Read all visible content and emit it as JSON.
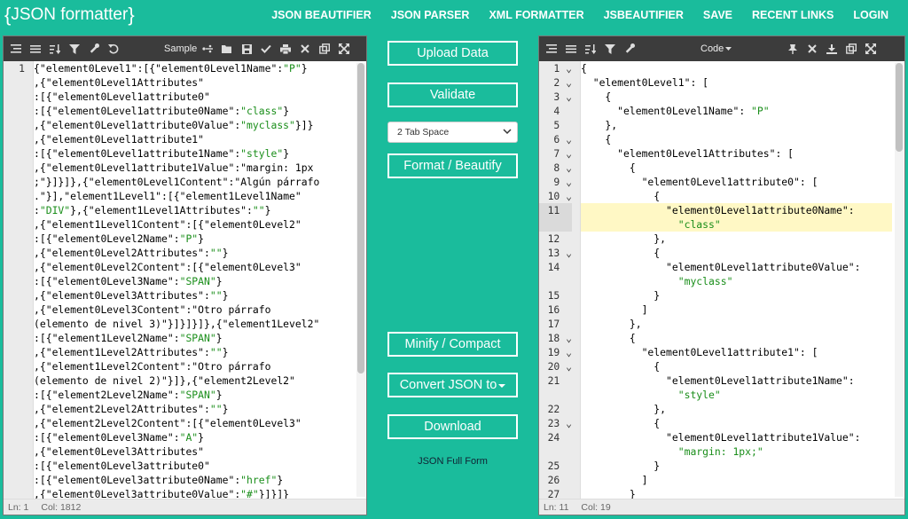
{
  "logo": {
    "open": "{",
    "text": "JSON formatter",
    "close": "}"
  },
  "nav": [
    "JSON BEAUTIFIER",
    "JSON PARSER",
    "XML FORMATTER",
    "JSBEAUTIFIER",
    "SAVE",
    "RECENT LINKS",
    "LOGIN"
  ],
  "left_panel": {
    "sample_label": "Sample",
    "line_number": "1",
    "status_ln": "Ln: 1",
    "status_col": "Col: 1812",
    "lines": [
      "{\"element0Level1\":[{\"element0Level1Name\":\"P\"}",
      ",{\"element0Level1Attributes\"",
      ":[{\"element0Level1attribute0\"",
      ":[{\"element0Level1attribute0Name\":\"class\"}",
      ",{\"element0Level1attribute0Value\":\"myclass\"}]}",
      ",{\"element0Level1attribute1\"",
      ":[{\"element0Level1attribute1Name\":\"style\"}",
      ",{\"element0Level1attribute1Value\":\"margin: 1px",
      ";\"}]}]},{\"element0Level1Content\":\"Algún párrafo",
      ".\"}],\"element1Level1\":[{\"element1Level1Name\"",
      ":\"DIV\"},{\"element1Level1Attributes\":\"\"}",
      ",{\"element1Level1Content\":[{\"element0Level2\"",
      ":[{\"element0Level2Name\":\"P\"}",
      ",{\"element0Level2Attributes\":\"\"}",
      ",{\"element0Level2Content\":[{\"element0Level3\"",
      ":[{\"element0Level3Name\":\"SPAN\"}",
      ",{\"element0Level3Attributes\":\"\"}",
      ",{\"element0Level3Content\":\"Otro párrafo",
      "(elemento de nivel 3)\"}]}]}]},{\"element1Level2\"",
      ":[{\"element1Level2Name\":\"SPAN\"}",
      ",{\"element1Level2Attributes\":\"\"}",
      ",{\"element1Level2Content\":\"Otro párrafo",
      "(elemento de nivel 2)\"}]},{\"element2Level2\"",
      ":[{\"element2Level2Name\":\"SPAN\"}",
      ",{\"element2Level2Attributes\":\"\"}",
      ",{\"element2Level2Content\":[{\"element0Level3\"",
      ":[{\"element0Level3Name\":\"A\"}",
      ",{\"element0Level3Attributes\"",
      ":[{\"element0Level3attribute0\"",
      ":[{\"element0Level3attribute0Name\":\"href\"}",
      ",{\"element0Level3attribute0Value\":\"#\"}]}]}"
    ]
  },
  "middle": {
    "upload": "Upload Data",
    "validate": "Validate",
    "tab_space": "2 Tab Space",
    "format": "Format / Beautify",
    "minify": "Minify / Compact",
    "convert": "Convert JSON to",
    "download": "Download",
    "full_form": "JSON Full Form"
  },
  "right_panel": {
    "code_label": "Code",
    "status_ln": "Ln: 11",
    "status_col": "Col: 19",
    "line_numbers": [
      "1",
      "2",
      "3",
      "4",
      "5",
      "6",
      "7",
      "8",
      "9",
      "10",
      "11",
      "",
      "12",
      "13",
      "14",
      "",
      "15",
      "16",
      "17",
      "18",
      "19",
      "20",
      "21",
      "",
      "22",
      "23",
      "24",
      "",
      "25",
      "26",
      "27"
    ],
    "lines": [
      "{",
      "  \"element0Level1\": [",
      "    {",
      "      \"element0Level1Name\": \"P\"",
      "    },",
      "    {",
      "      \"element0Level1Attributes\": [",
      "        {",
      "          \"element0Level1attribute0\": [",
      "            {",
      "              \"element0Level1attribute0Name\":",
      "                \"class\"",
      "            },",
      "            {",
      "              \"element0Level1attribute0Value\":",
      "                \"myclass\"",
      "            }",
      "          ]",
      "        },",
      "        {",
      "          \"element0Level1attribute1\": [",
      "            {",
      "              \"element0Level1attribute1Name\":",
      "                \"style\"",
      "            },",
      "            {",
      "              \"element0Level1attribute1Value\":",
      "                \"margin: 1px;\"",
      "            }",
      "          ]",
      "        }"
    ]
  }
}
